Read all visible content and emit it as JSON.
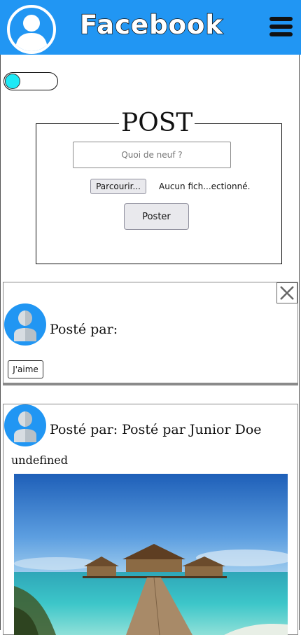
{
  "header": {
    "brand": "Facebook"
  },
  "composer": {
    "title": "POST",
    "input_placeholder": "Quoi de neuf ?",
    "browse_label": "Parcourir...",
    "file_status": "Aucun fich...ectionné.",
    "submit_label": "Poster"
  },
  "feed": {
    "posts": [
      {
        "author_line": "Posté par:",
        "like_label": "J'aime"
      },
      {
        "author_line": "Posté par: Posté par Junior Doe",
        "text": "undefined"
      }
    ]
  },
  "colors": {
    "brand_blue": "#2196F3",
    "toggle_knob": "#1de9f6"
  },
  "icons": [
    "user-avatar-icon",
    "hamburger-menu-icon",
    "close-icon"
  ]
}
